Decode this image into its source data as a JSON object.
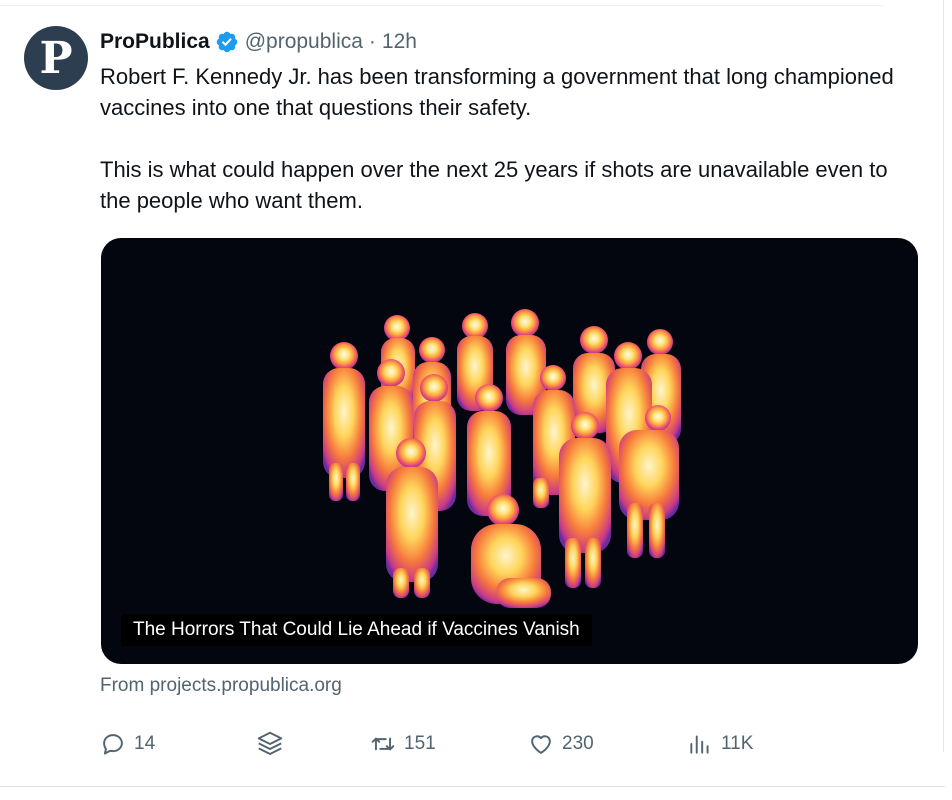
{
  "tweet": {
    "author_name": "ProPublica",
    "avatar_letter": "P",
    "handle": "@propublica",
    "separator": "·",
    "time": "12h",
    "paragraphs": [
      "Robert F. Kennedy Jr. has been transforming a government that long championed vaccines into one that questions their safety.",
      "This is what could happen over the next 25 years if shots are unavailable even to the people who want them."
    ],
    "card": {
      "caption": "The Horrors That Could Lie Ahead if Vaccines Vanish",
      "image": "thermal-silhouettes-of-children"
    },
    "source": "From projects.propublica.org"
  },
  "actions": {
    "replies": "14",
    "retweets": "151",
    "likes": "230",
    "views": "11K"
  },
  "icons": {
    "verified": "verified-badge-icon",
    "reply": "reply-icon",
    "stack": "stack-icon",
    "retweet": "retweet-icon",
    "like": "heart-icon",
    "views": "views-icon"
  },
  "colors": {
    "text": "#0f1419",
    "muted": "#536471",
    "verified": "#1d9bf0",
    "avatar_bg": "#2c3e50",
    "card_bg": "#03050f"
  }
}
